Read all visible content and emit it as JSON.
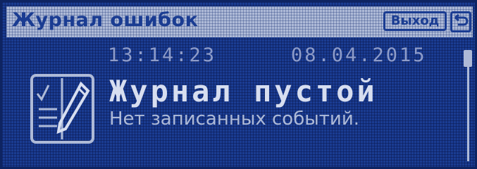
{
  "header": {
    "title": "Журнал ошибок",
    "exit_label": "Выход",
    "back_icon": "return-arrow-icon"
  },
  "status": {
    "time": "13:14:23",
    "date": "08.04.2015"
  },
  "message": {
    "icon": "log-book-pencil-icon",
    "headline": "Журнал пустой",
    "subtext": "Нет записанных событий."
  },
  "colors": {
    "background": "#1a3c92",
    "title_bar": "#aebad7",
    "headline_text": "#d7def0",
    "dim_text": "#8e9cc9"
  }
}
